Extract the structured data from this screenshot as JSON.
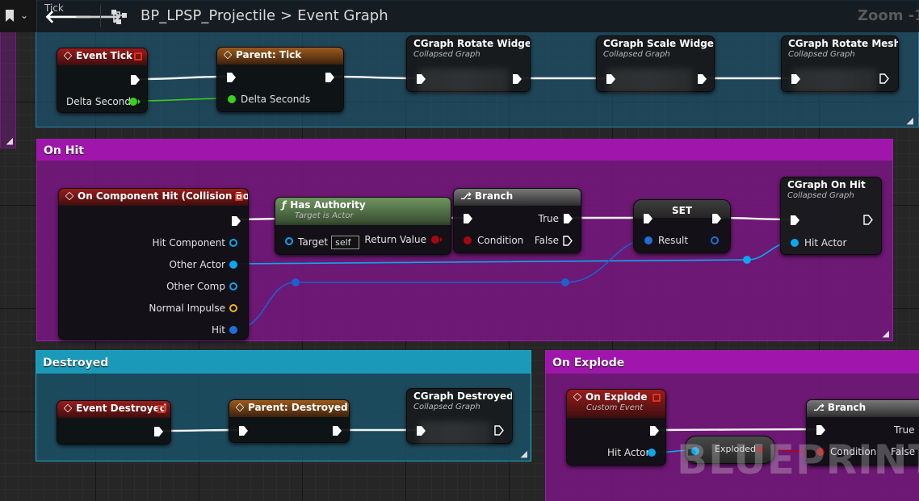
{
  "toolbar": {
    "tab_hint": "Tick",
    "back_glyph": "🡐",
    "forward_glyph": "🡒",
    "blueprint_name": "BP_LPSP_Projectile",
    "graph_name": "Event Graph",
    "zoom_text": "Zoom -1",
    "icons": [
      "bookmark-icon",
      "chevron-down-icon",
      "back-arrow-icon",
      "forward-arrow-icon",
      "graph-icon"
    ]
  },
  "comments": {
    "tick": {
      "color": "#1d5c7c"
    },
    "on_hit": {
      "title": "On Hit",
      "color": "#7e1a84"
    },
    "destroyed": {
      "title": "Destroyed",
      "color": "#1f6a85"
    },
    "on_explode": {
      "title": "On Explode",
      "color": "#7e1a84"
    }
  },
  "nodes": {
    "event_tick": {
      "title": "Event Tick",
      "pin_delta": "Delta Seconds"
    },
    "parent_tick": {
      "title": "Parent: Tick",
      "pin_delta": "Delta Seconds"
    },
    "cg_rotate_widget": {
      "title": "CGraph Rotate Widget",
      "subtitle": "Collapsed Graph"
    },
    "cg_scale_widget": {
      "title": "CGraph Scale Widget",
      "subtitle": "Collapsed Graph"
    },
    "cg_rotate_mesh": {
      "title": "CGraph Rotate Mesh",
      "subtitle": "Collapsed Graph"
    },
    "on_component_hit": {
      "title": "On Component Hit (Collision Box)",
      "pins": [
        "Hit Component",
        "Other Actor",
        "Other Comp",
        "Normal Impulse",
        "Hit"
      ]
    },
    "has_authority": {
      "title": "Has Authority",
      "subtitle": "Target is Actor",
      "pin_target": "Target",
      "target_value": "self",
      "pin_return": "Return Value"
    },
    "branch_hit": {
      "title": "Branch",
      "pin_condition": "Condition",
      "pin_true": "True",
      "pin_false": "False"
    },
    "set_node": {
      "title": "SET",
      "pin_result": "Result"
    },
    "cg_on_hit": {
      "title": "CGraph On Hit",
      "subtitle": "Collapsed Graph",
      "pin_hit_actor": "Hit Actor"
    },
    "event_destroyed": {
      "title": "Event Destroyed"
    },
    "parent_destroyed": {
      "title": "Parent: Destroyed"
    },
    "cg_destroyed": {
      "title": "CGraph Destroyed",
      "subtitle": "Collapsed Graph"
    },
    "on_explode": {
      "title": "On Explode",
      "subtitle": "Custom Event",
      "pin_hit_actor": "Hit Actor"
    },
    "exploded_var": {
      "title": "Exploded"
    },
    "branch_explode": {
      "title": "Branch",
      "pin_condition": "Condition",
      "pin_true": "True",
      "pin_false": "False"
    }
  },
  "pin_colors": {
    "exec": "#ffffff",
    "float": "#38d11b",
    "object": "#0ba6f0",
    "struct_hit": "#1f6fd6",
    "vector": "#f0b31c",
    "bool": "#a8060e"
  },
  "watermark": "BLUEPRINT"
}
